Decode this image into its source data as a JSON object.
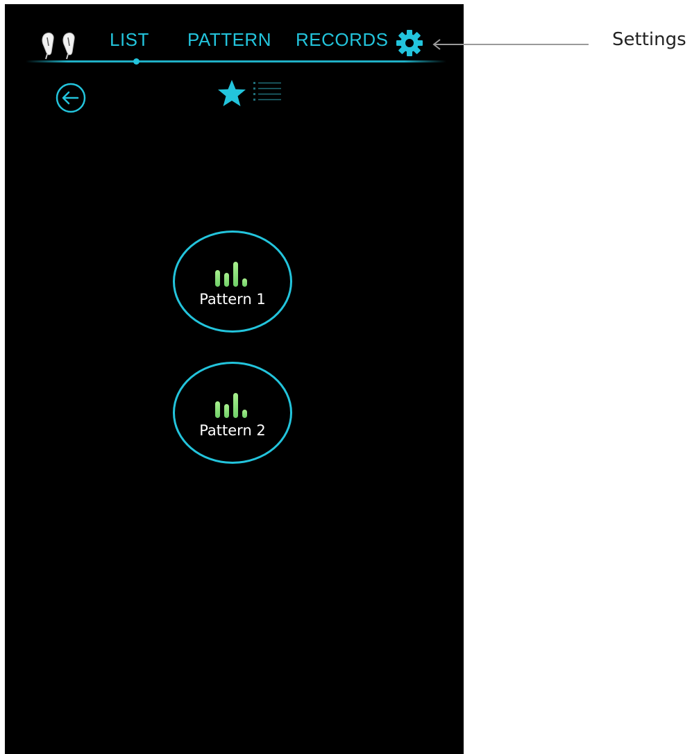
{
  "nav": {
    "tabs": [
      {
        "label": "LIST"
      },
      {
        "label": "PATTERN"
      },
      {
        "label": "RECORDS"
      }
    ],
    "active_tab": "LIST"
  },
  "toolbar": {
    "back_icon": "back-arrow-circle-icon",
    "favorite_icon": "star-icon",
    "list_view_icon": "list-icon"
  },
  "patterns": [
    {
      "label": "Pattern 1"
    },
    {
      "label": "Pattern 2"
    }
  ],
  "annotation": {
    "label": "Settings"
  },
  "colors": {
    "accent": "#23c4dc",
    "bars_green": "#8ee27a",
    "background": "#000000"
  }
}
